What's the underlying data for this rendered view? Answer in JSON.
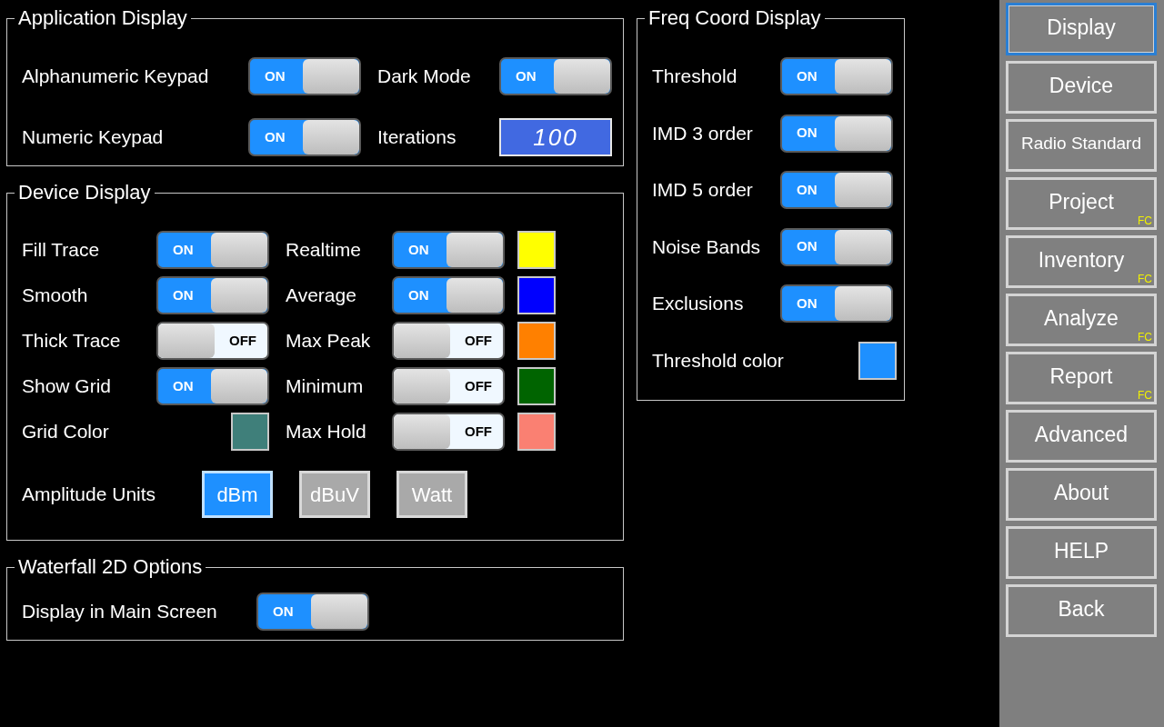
{
  "application_display": {
    "title": "Application Display",
    "items": [
      {
        "kind": "toggle",
        "label": "Alphanumeric Keypad",
        "on": true,
        "state_text": "ON"
      },
      {
        "kind": "toggle",
        "label": "Dark Mode",
        "on": true,
        "state_text": "ON"
      },
      {
        "kind": "toggle",
        "label": "Numeric Keypad",
        "on": true,
        "state_text": "ON"
      },
      {
        "kind": "number",
        "label": "Iterations",
        "value": "100"
      }
    ]
  },
  "device_display": {
    "title": "Device Display",
    "items": [
      {
        "kind": "toggle",
        "label": "Fill Trace",
        "on": true,
        "state_text": "ON"
      },
      {
        "kind": "toggle",
        "label": "Realtime",
        "on": true,
        "state_text": "ON",
        "color": "#ffff00"
      },
      {
        "kind": "toggle",
        "label": "Smooth",
        "on": true,
        "state_text": "ON"
      },
      {
        "kind": "toggle",
        "label": "Average",
        "on": true,
        "state_text": "ON",
        "color": "#0000ff"
      },
      {
        "kind": "toggle",
        "label": "Thick Trace",
        "on": false,
        "state_text": "OFF"
      },
      {
        "kind": "toggle",
        "label": "Max Peak",
        "on": false,
        "state_text": "OFF",
        "color": "#ff8000"
      },
      {
        "kind": "toggle",
        "label": "Show Grid",
        "on": true,
        "state_text": "ON"
      },
      {
        "kind": "toggle",
        "label": "Minimum",
        "on": false,
        "state_text": "OFF",
        "color": "#006400"
      },
      {
        "kind": "color",
        "label": "Grid Color",
        "color": "#3f7f7a"
      },
      {
        "kind": "toggle",
        "label": "Max Hold",
        "on": false,
        "state_text": "OFF",
        "color": "#fa8072"
      }
    ],
    "amplitude_units": {
      "label": "Amplitude Units",
      "options": [
        {
          "label": "dBm",
          "selected": true
        },
        {
          "label": "dBuV",
          "selected": false
        },
        {
          "label": "Watt",
          "selected": false
        }
      ]
    }
  },
  "waterfall_2d_options": {
    "title": "Waterfall 2D Options",
    "items": [
      {
        "kind": "toggle",
        "label": "Display in Main Screen",
        "on": true,
        "state_text": "ON"
      }
    ]
  },
  "freq_coord_display": {
    "title": "Freq Coord Display",
    "items": [
      {
        "kind": "toggle",
        "label": "Threshold",
        "on": true,
        "state_text": "ON"
      },
      {
        "kind": "toggle",
        "label": "IMD 3 order",
        "on": true,
        "state_text": "ON"
      },
      {
        "kind": "toggle",
        "label": "IMD 5 order",
        "on": true,
        "state_text": "ON"
      },
      {
        "kind": "toggle",
        "label": "Noise Bands",
        "on": true,
        "state_text": "ON"
      },
      {
        "kind": "toggle",
        "label": "Exclusions",
        "on": true,
        "state_text": "ON"
      },
      {
        "kind": "color",
        "label": "Threshold color",
        "color": "#1e90ff"
      }
    ]
  },
  "sidebar": {
    "items": [
      {
        "label": "Display",
        "selected": true
      },
      {
        "label": "Device",
        "selected": false
      },
      {
        "label": "Radio Standard",
        "selected": false,
        "compact": true
      },
      {
        "label": "Project",
        "selected": false,
        "badge": "FC"
      },
      {
        "label": "Inventory",
        "selected": false,
        "badge": "FC"
      },
      {
        "label": "Analyze",
        "selected": false,
        "badge": "FC"
      },
      {
        "label": "Report",
        "selected": false,
        "badge": "FC"
      },
      {
        "label": "Advanced",
        "selected": false
      },
      {
        "label": "About",
        "selected": false
      },
      {
        "label": "HELP",
        "selected": false
      },
      {
        "label": "Back",
        "selected": false
      }
    ]
  }
}
